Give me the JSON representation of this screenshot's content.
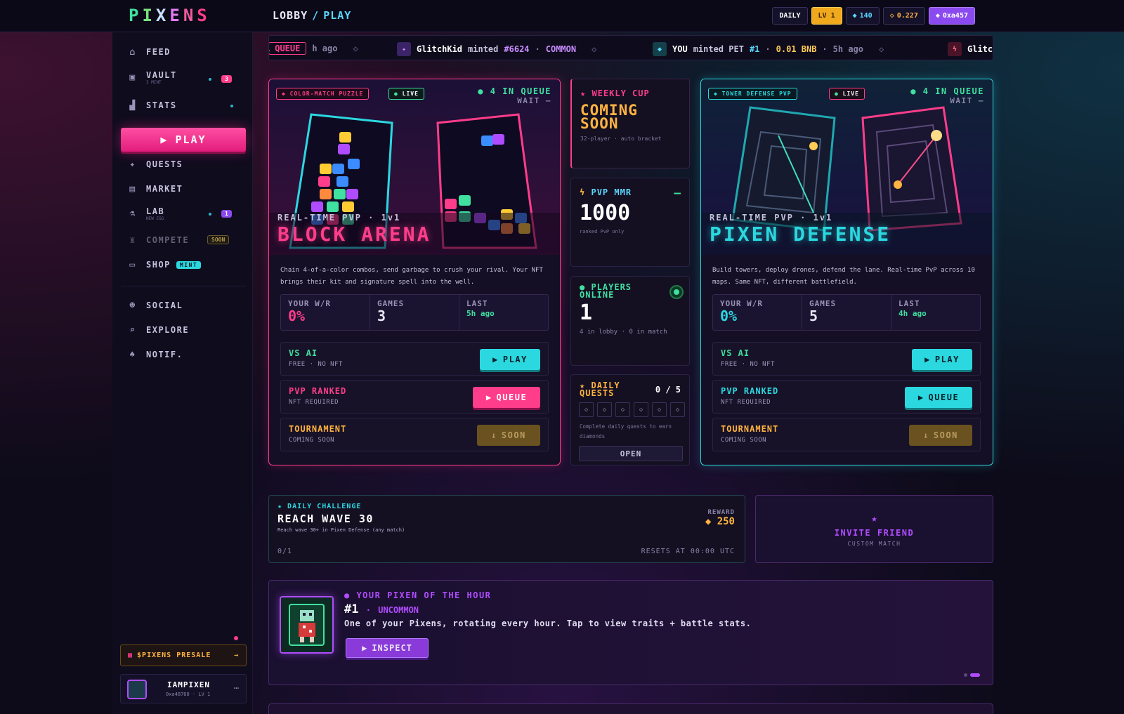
{
  "app": {
    "logo": [
      "P",
      "I",
      "X",
      "E",
      "N",
      "S"
    ]
  },
  "breadcrumb": {
    "root": "LOBBY",
    "sep": "/",
    "current": "PLAY"
  },
  "header_pills": {
    "daily": "DAILY",
    "level": "LV 1",
    "gems": "140",
    "bnb": "0.227",
    "wallet": "0xa457"
  },
  "sidebar": {
    "items": [
      {
        "label": "FEED",
        "icon": "home-icon"
      },
      {
        "label": "VAULT",
        "sub": "3 MINT",
        "badge": "3",
        "icon": "vault-icon"
      },
      {
        "label": "STATS",
        "icon": "bar-chart-icon"
      },
      {
        "label": "QUESTS",
        "icon": "quests-icon"
      },
      {
        "label": "MARKET",
        "icon": "market-icon"
      },
      {
        "label": "LAB",
        "sub": "NEW EGG",
        "badge": "1",
        "icon": "flask-icon"
      },
      {
        "label": "COMPETE",
        "badge": "SOON",
        "icon": "trophy-icon"
      },
      {
        "label": "SHOP",
        "badge": "MINT",
        "icon": "shop-icon"
      },
      {
        "label": "SOCIAL",
        "icon": "social-icon"
      },
      {
        "label": "EXPLORE",
        "icon": "explore-icon"
      },
      {
        "label": "NOTIF.",
        "icon": "bell-icon"
      }
    ],
    "play_label": "PLAY",
    "presale_label": "$PIXENS PRESALE",
    "user": {
      "name": "IAMPIXEN",
      "sub": "0xa48760 · LV 1"
    }
  },
  "ticker": {
    "queue_label": "QUEUE",
    "partial": "1",
    "partial_time": "h ago",
    "items": [
      {
        "user": "GlitchKid",
        "verb": "minted",
        "id": "#6624",
        "sep": "·",
        "rarity": "COMMON"
      },
      {
        "user": "YOU",
        "verb": "minted PET",
        "id": "#1",
        "sep": "·",
        "amount": "0.01 BNB",
        "time": "5h ago"
      },
      {
        "user": "Glitc"
      }
    ]
  },
  "block_arena": {
    "tag": "COLOR-MATCH PUZZLE",
    "live": "LIVE",
    "queue": "4 IN QUEUE",
    "wait": "WAIT —",
    "sub": "REAL-TIME PVP · 1v1",
    "title": "BLOCK ARENA",
    "desc": "Chain 4-of-a-color combos, send garbage to crush your rival. Your NFT brings their kit and signature spell into the well.",
    "stats": {
      "wr_label": "YOUR W/R",
      "wr": "0%",
      "games_label": "GAMES",
      "games": "3",
      "last_label": "LAST",
      "last": "5h ago"
    },
    "modes": [
      {
        "title": "VS AI",
        "sub": "FREE · NO NFT",
        "btn": "PLAY"
      },
      {
        "title": "PVP RANKED",
        "sub": "NFT REQUIRED",
        "btn": "QUEUE"
      },
      {
        "title": "TOURNAMENT",
        "sub": "COMING SOON",
        "btn": "SOON"
      }
    ]
  },
  "pixen_defense": {
    "tag": "TOWER DEFENSE PVP",
    "live": "LIVE",
    "queue": "4 IN QUEUE",
    "wait": "WAIT —",
    "sub": "REAL-TIME PVP · 1v1",
    "title": "PIXEN DEFENSE",
    "desc": "Build towers, deploy drones, defend the lane. Real-time PvP across 10 maps. Same NFT, different battlefield.",
    "stats": {
      "wr_label": "YOUR W/R",
      "wr": "0%",
      "games_label": "GAMES",
      "games": "5",
      "last_label": "LAST",
      "last": "4h ago"
    },
    "modes": [
      {
        "title": "VS AI",
        "sub": "FREE · NO NFT",
        "btn": "PLAY"
      },
      {
        "title": "PVP RANKED",
        "sub": "NFT REQUIRED",
        "btn": "QUEUE"
      },
      {
        "title": "TOURNAMENT",
        "sub": "COMING SOON",
        "btn": "SOON"
      }
    ]
  },
  "weekly_cup": {
    "title": "WEEKLY CUP",
    "status": "COMING SOON",
    "sub": "32-player · auto bracket"
  },
  "pvp_mmr": {
    "title": "PVP MMR",
    "dash": "—",
    "value": "1000",
    "sub": "ranked PvP only"
  },
  "players_online": {
    "title": "PLAYERS ONLINE",
    "value": "1",
    "sub": "4 in lobby · 0 in match"
  },
  "daily_quests": {
    "title": "DAILY QUESTS",
    "progress": "0 / 5",
    "slots": [
      "◇",
      "◇",
      "◇",
      "◇",
      "◇",
      "◇"
    ],
    "sub": "Complete daily quests to earn diamonds",
    "btn": "OPEN"
  },
  "daily_challenge": {
    "tag": "DAILY CHALLENGE",
    "title": "REACH WAVE 30",
    "sub": "Reach wave 30+ in Pixen Defense (any match)",
    "reward_label": "REWARD",
    "reward": "250",
    "progress": "0/1",
    "resets": "RESETS AT 00:00 UTC"
  },
  "invite": {
    "title": "INVITE FRIEND",
    "sub": "CUSTOM MATCH"
  },
  "pixen_hour": {
    "tag": "YOUR PIXEN OF THE HOUR",
    "id": "#1",
    "sep": "·",
    "rarity": "UNCOMMON",
    "desc": "One of your Pixens, rotating every hour. Tap to view traits + battle stats.",
    "btn": "INSPECT"
  },
  "colors": {
    "pink": "#ff3d8a",
    "cyan": "#2bd8e0",
    "green": "#3fe0a0",
    "gold": "#ffb340",
    "purple": "#b04cff"
  }
}
